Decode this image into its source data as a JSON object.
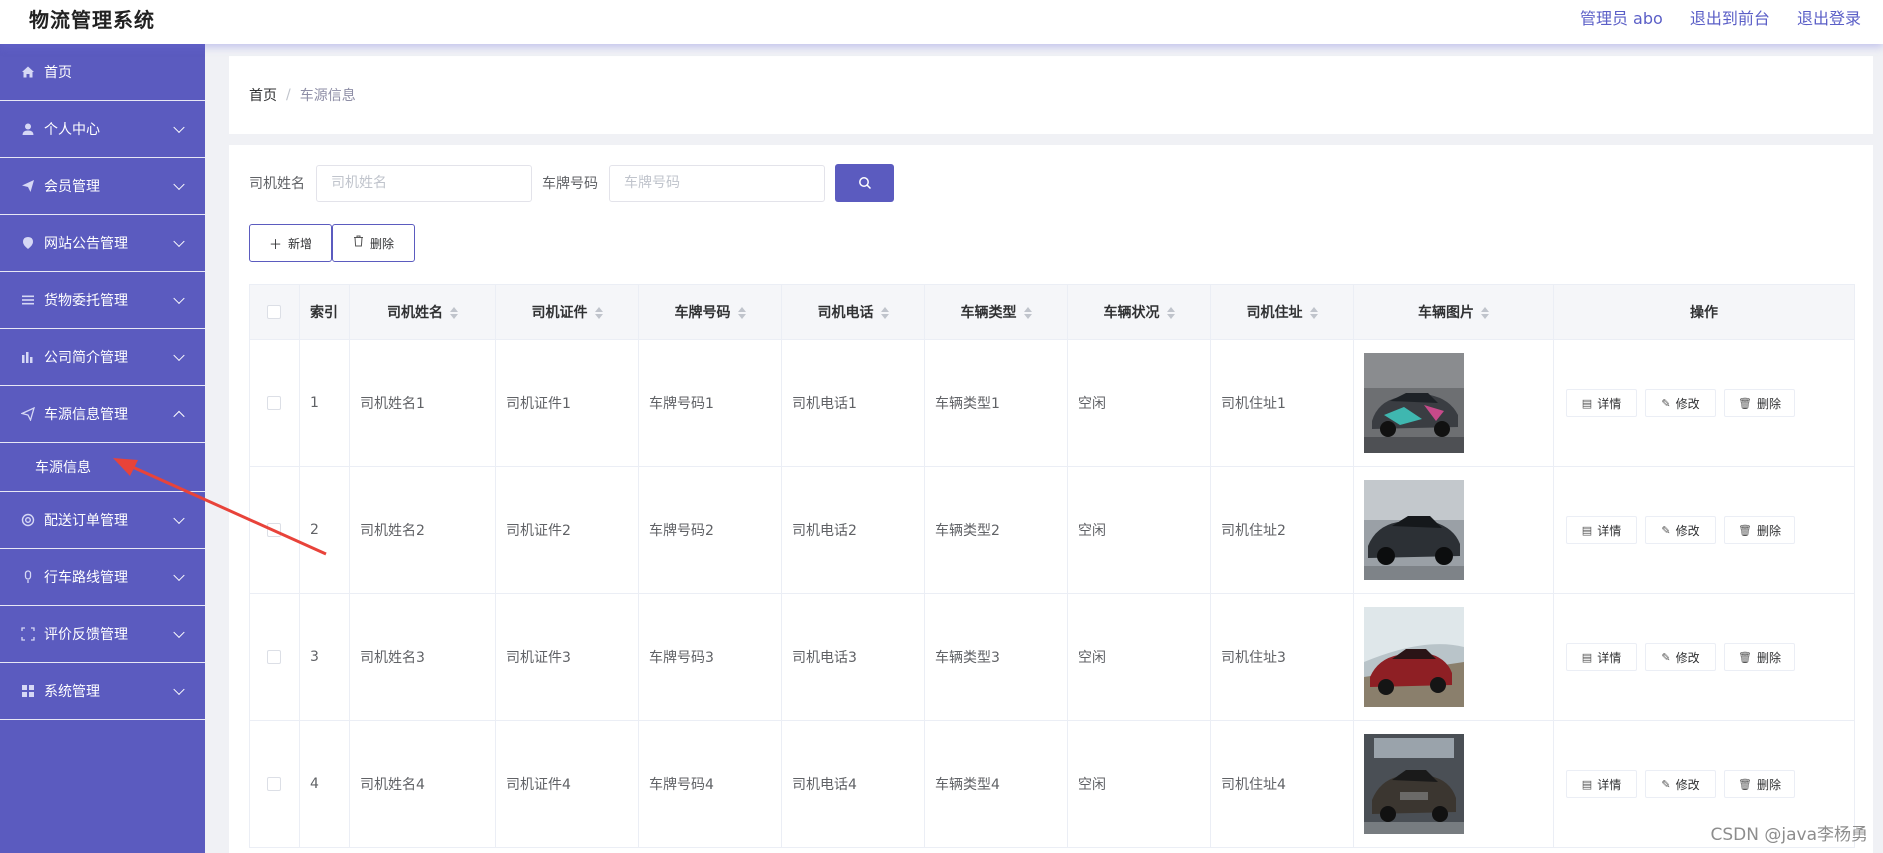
{
  "header": {
    "app_title": "物流管理系统",
    "admin_label": "管理员 abo",
    "back_front_label": "退出到前台",
    "logout_label": "退出登录"
  },
  "sidebar": {
    "items": [
      {
        "label": "首页",
        "icon": "home-icon"
      },
      {
        "label": "个人中心",
        "icon": "user-icon"
      },
      {
        "label": "会员管理",
        "icon": "send-icon"
      },
      {
        "label": "网站公告管理",
        "icon": "location-icon"
      },
      {
        "label": "货物委托管理",
        "icon": "menu-icon"
      },
      {
        "label": "公司简介管理",
        "icon": "chart-icon"
      },
      {
        "label": "车源信息管理",
        "icon": "send-icon"
      },
      {
        "label": "配送订单管理",
        "icon": "help-icon"
      },
      {
        "label": "行车路线管理",
        "icon": "microphone-icon"
      },
      {
        "label": "评价反馈管理",
        "icon": "fullscreen-icon"
      },
      {
        "label": "系统管理",
        "icon": "grid-icon"
      }
    ],
    "submenu_label": "车源信息"
  },
  "breadcrumb": {
    "home": "首页",
    "separator": "/",
    "current": "车源信息"
  },
  "search": {
    "driver_name_label": "司机姓名",
    "driver_name_placeholder": "司机姓名",
    "plate_label": "车牌号码",
    "plate_placeholder": "车牌号码"
  },
  "actions": {
    "add_label": "新增",
    "delete_label": "删除"
  },
  "table": {
    "headers": [
      "索引",
      "司机姓名",
      "司机证件",
      "车牌号码",
      "司机电话",
      "车辆类型",
      "车辆状况",
      "司机住址",
      "车辆图片",
      "操作"
    ],
    "rows": [
      {
        "index": "1",
        "name": "司机姓名1",
        "cert": "司机证件1",
        "plate": "车牌号码1",
        "phone": "司机电话1",
        "type": "车辆类型1",
        "status": "空闲",
        "address": "司机住址1"
      },
      {
        "index": "2",
        "name": "司机姓名2",
        "cert": "司机证件2",
        "plate": "车牌号码2",
        "phone": "司机电话2",
        "type": "车辆类型2",
        "status": "空闲",
        "address": "司机住址2"
      },
      {
        "index": "3",
        "name": "司机姓名3",
        "cert": "司机证件3",
        "plate": "车牌号码3",
        "phone": "司机电话3",
        "type": "车辆类型3",
        "status": "空闲",
        "address": "司机住址3"
      },
      {
        "index": "4",
        "name": "司机姓名4",
        "cert": "司机证件4",
        "plate": "车牌号码4",
        "phone": "司机电话4",
        "type": "车辆类型4",
        "status": "空闲",
        "address": "司机住址4"
      }
    ],
    "row_actions": {
      "detail": "详情",
      "edit": "修改",
      "delete": "删除"
    }
  },
  "watermark": "CSDN @java李杨勇",
  "colors": {
    "accent": "#5b5bbf",
    "arrow": "#e8433a"
  }
}
